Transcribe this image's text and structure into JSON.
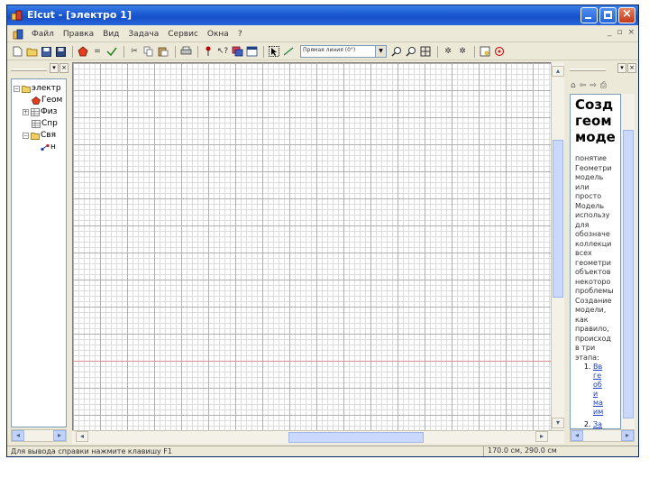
{
  "window": {
    "title": "Elcut - [электро 1]"
  },
  "menu": {
    "items": [
      "Файл",
      "Правка",
      "Вид",
      "Задача",
      "Сервис",
      "Окна",
      "?"
    ]
  },
  "mdi_controls": {
    "minimize": "_",
    "restore": "▫",
    "close": "×"
  },
  "toolbar": {
    "combo_value": "Прямая линия (0°)"
  },
  "tree": {
    "items": [
      {
        "label": "электр",
        "icon": "folder-icon",
        "expander": "−"
      },
      {
        "label": "Геом",
        "icon": "geometry-icon"
      },
      {
        "label": "Физ",
        "icon": "table-icon",
        "expander": "+"
      },
      {
        "label": "Спр",
        "icon": "table-icon"
      },
      {
        "label": "Свя",
        "icon": "folder-icon",
        "expander": "−"
      },
      {
        "label": "н",
        "icon": "link-icon"
      }
    ]
  },
  "help": {
    "heading": [
      "Созд",
      "геом",
      "моде"
    ],
    "paragraph1": [
      "понятие",
      "Геометри",
      "модель",
      "или",
      "просто",
      "Модель",
      "использу",
      "для",
      "обозначе",
      "коллекци",
      "всех",
      "геометри",
      "объектов",
      "некоторо",
      "проблемы"
    ],
    "paragraph2": [
      "Создание",
      "модели,",
      "как",
      "правило,",
      "происход",
      "в три",
      "этапа:"
    ],
    "list": [
      {
        "lines": [
          "Вв",
          "ге",
          "об",
          "и",
          "ма",
          "им"
        ]
      },
      {
        "lines": [
          "За"
        ]
      }
    ]
  },
  "status": {
    "hint": "Для вывода справки нажмите клавишу F1",
    "coords": "170.0 см, 290.0 см"
  },
  "colors": {
    "titlebar": "#1d5dd6",
    "chrome": "#ece9d8",
    "grid": "#b0b0b0",
    "link": "#2040c0"
  }
}
